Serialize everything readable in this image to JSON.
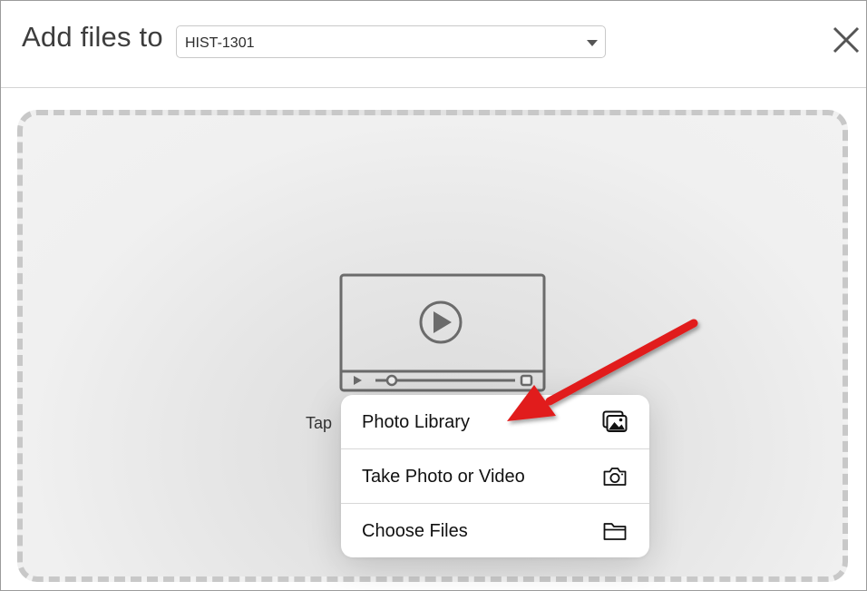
{
  "header": {
    "title": "Add files to",
    "course_select": {
      "value": "HIST-1301"
    }
  },
  "drop_zone": {
    "hint_text": "Tap"
  },
  "menu": {
    "items": [
      {
        "label": "Photo Library",
        "icon": "photo-library-icon"
      },
      {
        "label": "Take Photo or Video",
        "icon": "camera-icon"
      },
      {
        "label": "Choose Files",
        "icon": "folder-icon"
      }
    ]
  },
  "annotation": {
    "arrow_color": "#e11d1d"
  }
}
